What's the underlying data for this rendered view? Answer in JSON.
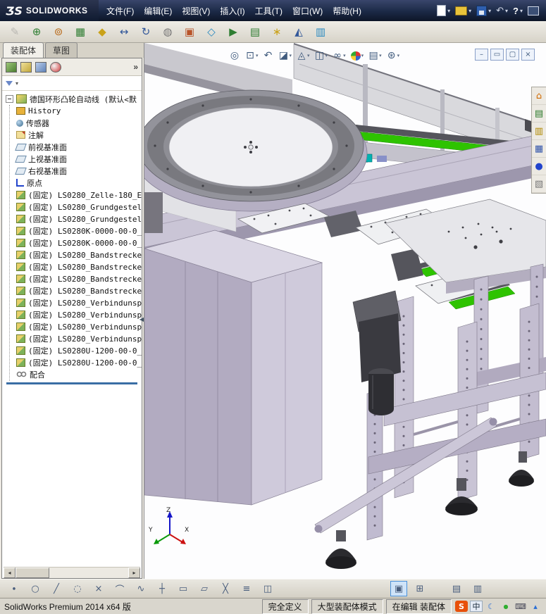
{
  "colors": {
    "titlebar": "#1b2946",
    "accent_blue": "#2f5fae",
    "model_green": "#2ec300",
    "model_lavender": "#cac5d6",
    "rollback_blue": "#3a6ea5",
    "sogou_orange": "#e8500a"
  },
  "glyphs": {
    "caret": "▾",
    "chevron": "»",
    "scroll_left": "◂",
    "scroll_right": "▸",
    "collapse_arrow": "◀",
    "help": "?",
    "undo": "↶"
  },
  "titlebar": {
    "logo_mark": "ƷS",
    "logo_text": "SOLIDWORKS",
    "menus": [
      "文件(F)",
      "编辑(E)",
      "视图(V)",
      "插入(I)",
      "工具(T)",
      "窗口(W)",
      "帮助(H)"
    ]
  },
  "assembly_toolbar": [
    {
      "name": "edit-component-button",
      "glyph": "✎",
      "state": "disabled"
    },
    {
      "name": "insert-components-button",
      "glyph": "⊕"
    },
    {
      "name": "mate-button",
      "glyph": "⊚"
    },
    {
      "name": "component-pattern-button",
      "glyph": "▦"
    },
    {
      "name": "smart-fasteners-button",
      "glyph": "◆"
    },
    {
      "name": "move-component-button",
      "glyph": "↔"
    },
    {
      "name": "rotate-component-button",
      "glyph": "↻"
    },
    {
      "name": "show-hidden-button",
      "glyph": "◍"
    },
    {
      "name": "assembly-features-button",
      "glyph": "▣"
    },
    {
      "name": "reference-geometry-button",
      "glyph": "◇"
    },
    {
      "name": "motion-study-button",
      "glyph": "▶"
    },
    {
      "name": "bom-button",
      "glyph": "▤"
    },
    {
      "name": "exploded-view-button",
      "glyph": "∗"
    },
    {
      "name": "instant3d-button",
      "glyph": "◭"
    },
    {
      "name": "large-assembly-button",
      "glyph": "▥"
    }
  ],
  "panel": {
    "tabs": [
      {
        "name": "tab-assembly",
        "label": "装配体",
        "state": "active"
      },
      {
        "name": "tab-sketch",
        "label": "草图"
      }
    ],
    "tree": {
      "root": "德国环形凸轮自动线 (默认<默",
      "items": [
        {
          "icon": "history",
          "label": "History"
        },
        {
          "icon": "sensor",
          "label": "传感器"
        },
        {
          "icon": "annotation",
          "label": "注解"
        },
        {
          "icon": "plane",
          "label": "前视基准面"
        },
        {
          "icon": "plane",
          "label": "上视基准面"
        },
        {
          "icon": "plane",
          "label": "右视基准面"
        },
        {
          "icon": "origin",
          "label": "原点"
        },
        {
          "icon": "component",
          "label": "(固定) LS0280_Zelle-180_E"
        },
        {
          "icon": "component",
          "label": "(固定) LS0280_Grundgestell"
        },
        {
          "icon": "component",
          "label": "(固定) LS0280_Grundgestell"
        },
        {
          "icon": "component",
          "label": "(固定) LS0280K-0000-00-0_"
        },
        {
          "icon": "component",
          "label": "(固定) LS0280K-0000-00-0_"
        },
        {
          "icon": "component",
          "label": "(固定) LS0280_Bandstrecke"
        },
        {
          "icon": "component",
          "label": "(固定) LS0280_Bandstrecke"
        },
        {
          "icon": "component",
          "label": "(固定) LS0280_Bandstrecke"
        },
        {
          "icon": "component",
          "label": "(固定) LS0280_Bandstrecke"
        },
        {
          "icon": "component",
          "label": "(固定) LS0280_Verbindunsp"
        },
        {
          "icon": "component",
          "label": "(固定) LS0280_Verbindunsp"
        },
        {
          "icon": "component",
          "label": "(固定) LS0280_Verbindunsp"
        },
        {
          "icon": "component",
          "label": "(固定) LS0280_Verbindunsp"
        },
        {
          "icon": "component",
          "label": "(固定) LS0280U-1200-00-0_"
        },
        {
          "icon": "component",
          "label": "(固定) LS0280U-1200-00-0_"
        },
        {
          "icon": "mates",
          "label": "配合"
        }
      ]
    }
  },
  "viewport": {
    "hud": [
      {
        "name": "zoom-fit-icon",
        "glyph": "◎",
        "caret": ""
      },
      {
        "name": "zoom-area-icon",
        "glyph": "⊡",
        "caret": "▾"
      },
      {
        "name": "previous-view-icon",
        "glyph": "↶",
        "caret": ""
      },
      {
        "name": "section-view-icon",
        "glyph": "◪",
        "caret": "▾"
      },
      {
        "name": "view-orientation-icon",
        "glyph": "◬",
        "caret": "▾"
      },
      {
        "name": "display-style-icon",
        "glyph": "◫",
        "caret": "▾"
      },
      {
        "name": "hide-show-items-icon",
        "glyph": "∞",
        "caret": "▾"
      },
      {
        "name": "edit-appearance-icon",
        "glyph": "",
        "caret": "▾"
      },
      {
        "name": "apply-scene-icon",
        "glyph": "▤",
        "caret": "▾"
      },
      {
        "name": "view-settings-icon",
        "glyph": "⊛",
        "caret": "▾"
      }
    ],
    "doc_controls": [
      {
        "name": "doc-minimize-button",
        "glyph": "–"
      },
      {
        "name": "doc-restore-button",
        "glyph": "▭"
      },
      {
        "name": "doc-maximize-button",
        "glyph": "▢"
      },
      {
        "name": "doc-close-button",
        "glyph": "×"
      }
    ],
    "task_tabs": [
      {
        "name": "task-home-icon",
        "glyph": "⌂"
      },
      {
        "name": "task-design-library-icon",
        "glyph": "▤"
      },
      {
        "name": "task-file-explorer-icon",
        "glyph": "▥"
      },
      {
        "name": "task-view-palette-icon",
        "glyph": "▦"
      },
      {
        "name": "task-appearances-icon",
        "glyph": "●"
      },
      {
        "name": "task-custom-properties-icon",
        "glyph": "▧"
      }
    ],
    "triad": {
      "x": "X",
      "y": "Y",
      "z": "Z"
    }
  },
  "sketch_toolbar": [
    {
      "name": "point-tool",
      "glyph": "∙"
    },
    {
      "name": "circle-tool",
      "glyph": "○"
    },
    {
      "name": "line-tool",
      "glyph": "╱"
    },
    {
      "name": "ellipse-tool",
      "glyph": "◌"
    },
    {
      "name": "erase-tool",
      "glyph": "×"
    },
    {
      "name": "arc-tool",
      "glyph": "⌒"
    },
    {
      "name": "spline-tool",
      "glyph": "∿"
    },
    {
      "name": "centerline-tool",
      "glyph": "┼"
    },
    {
      "name": "rectangle-tool",
      "glyph": "▭"
    },
    {
      "name": "slot-tool",
      "glyph": "▱"
    },
    {
      "name": "trim-tool",
      "glyph": "╳"
    },
    {
      "name": "offset-tool",
      "glyph": "≡"
    },
    {
      "name": "mirror-tool",
      "glyph": "◫"
    },
    {
      "name": "spacer",
      "glyph": "",
      "state": "spacer"
    },
    {
      "name": "shaded-sketch-contours-tool",
      "glyph": "▣",
      "state": "active"
    },
    {
      "name": "grid-tool",
      "glyph": "⊞"
    },
    {
      "name": "spacer2",
      "glyph": "",
      "state": "spacer2"
    },
    {
      "name": "table-tool",
      "glyph": "▤"
    },
    {
      "name": "pattern-tool",
      "glyph": "▥"
    }
  ],
  "statusbar": {
    "app": "SolidWorks Premium 2014 x64 版",
    "fields": [
      {
        "name": "constraint-status",
        "label": "完全定义"
      },
      {
        "name": "assembly-mode-indicator",
        "label": "大型装配体模式"
      },
      {
        "name": "edit-mode-indicator",
        "label": "在编辑 装配体"
      }
    ],
    "ime": [
      {
        "name": "ime-sogou-icon",
        "glyph": "S"
      },
      {
        "name": "ime-lang-icon",
        "glyph": "中"
      },
      {
        "name": "ime-moon-icon",
        "glyph": "☾"
      },
      {
        "name": "ime-status-icon",
        "glyph": "●"
      },
      {
        "name": "ime-keyboard-icon",
        "glyph": "⌨"
      },
      {
        "name": "ime-up-icon",
        "glyph": "▴"
      }
    ]
  }
}
